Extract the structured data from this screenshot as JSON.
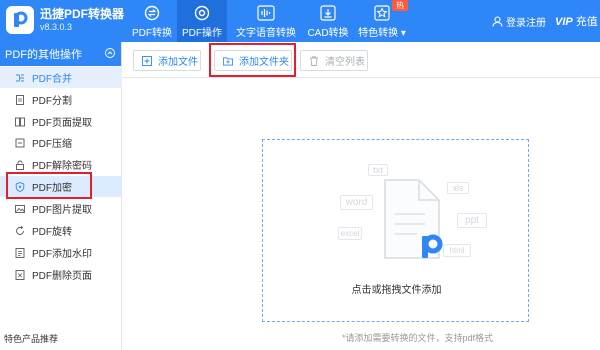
{
  "app": {
    "title": "迅捷PDF转换器",
    "version": "v8.3.0.3"
  },
  "nav": [
    {
      "label": "PDF转换",
      "icon": "convert-icon"
    },
    {
      "label": "PDF操作",
      "icon": "gear-icon",
      "active": true
    },
    {
      "label": "文字语音转换",
      "icon": "waveform-icon"
    },
    {
      "label": "CAD转换",
      "icon": "cad-icon"
    },
    {
      "label": "特色转换",
      "icon": "star-icon",
      "badge": "热",
      "dropdown": true
    }
  ],
  "account": {
    "login_label": "登录注册",
    "vip_mark": "VIP",
    "vip_label": "充值"
  },
  "sidebar": {
    "header": "PDF的其他操作",
    "items": [
      {
        "label": "PDF合并",
        "icon": "merge-icon",
        "active": true
      },
      {
        "label": "PDF分割",
        "icon": "split-icon"
      },
      {
        "label": "PDF页面提取",
        "icon": "extract-icon"
      },
      {
        "label": "PDF压缩",
        "icon": "compress-icon"
      },
      {
        "label": "PDF解除密码",
        "icon": "unlock-icon"
      },
      {
        "label": "PDF加密",
        "icon": "shield-icon",
        "selected": true
      },
      {
        "label": "PDF图片提取",
        "icon": "image-icon"
      },
      {
        "label": "PDF旋转",
        "icon": "rotate-icon"
      },
      {
        "label": "PDF添加水印",
        "icon": "watermark-icon"
      },
      {
        "label": "PDF删除页面",
        "icon": "delete-page-icon"
      }
    ],
    "footer": "特色产品推荐"
  },
  "toolbar": {
    "add_file": "添加文件",
    "add_folder": "添加文件夹",
    "clear_list": "清空列表"
  },
  "dropzone": {
    "text": "点击或拖拽文件添加",
    "ghost_labels": [
      "txt",
      "word",
      "xls",
      "ppt",
      "excel",
      "html"
    ]
  },
  "hint": "*请添加需要转换的文件，支持pdf格式",
  "colors": {
    "brand": "#2f86f6",
    "header_active": "#1f6fdc",
    "highlight": "#e0202e",
    "hot": "#ff5a3a"
  }
}
